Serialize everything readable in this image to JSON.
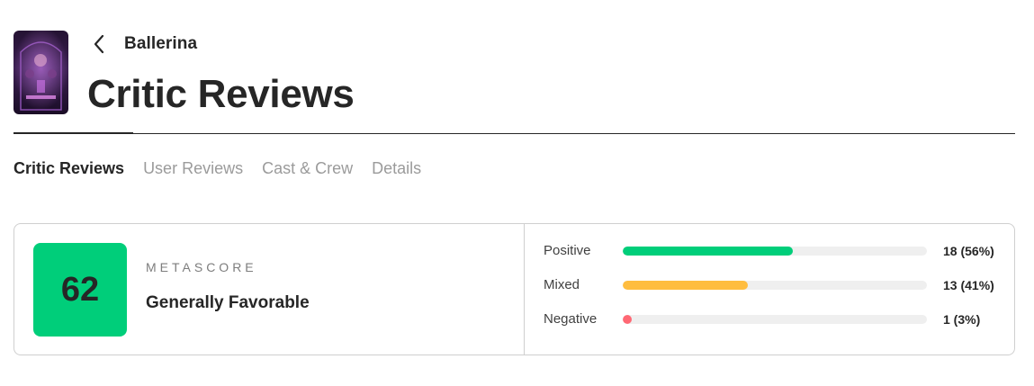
{
  "header": {
    "back_title": "Ballerina",
    "page_title": "Critic Reviews"
  },
  "tabs": [
    {
      "label": "Critic Reviews",
      "active": true
    },
    {
      "label": "User Reviews",
      "active": false
    },
    {
      "label": "Cast & Crew",
      "active": false
    },
    {
      "label": "Details",
      "active": false
    }
  ],
  "metascore": {
    "value": "62",
    "label": "METASCORE",
    "description": "Generally Favorable",
    "color": "#00ce7a"
  },
  "distribution": [
    {
      "label": "Positive",
      "count": "18 (56%)",
      "fraction": 0.56,
      "color": "#00ce7a"
    },
    {
      "label": "Mixed",
      "count": "13 (41%)",
      "fraction": 0.41,
      "color": "#ffbd3f"
    },
    {
      "label": "Negative",
      "count": "1 (3%)",
      "fraction": 0.03,
      "color": "#ff6874"
    }
  ]
}
